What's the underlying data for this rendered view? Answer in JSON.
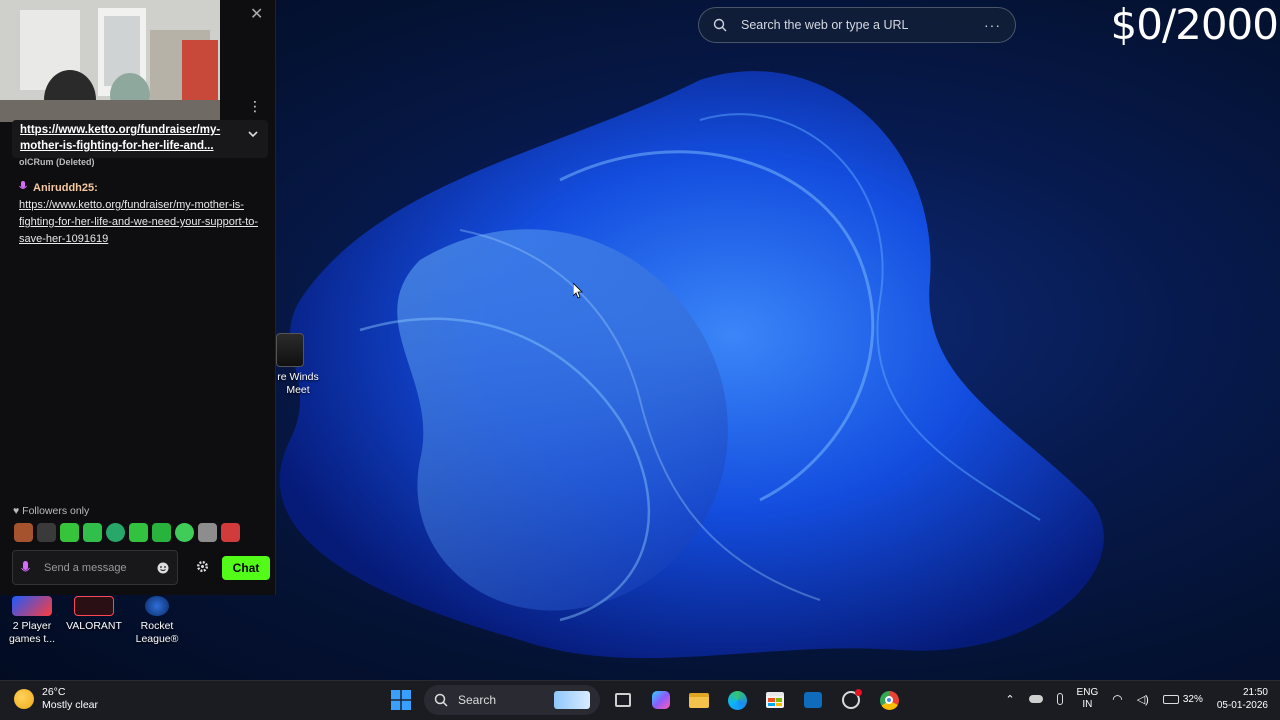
{
  "overlay": {
    "goal": "$0/2000"
  },
  "browser_search": {
    "placeholder": "Search the web or type a URL",
    "menu": "···"
  },
  "chat": {
    "pinned_link": "https://www.ketto.org/fundraiser/my-mother-is-fighting-for-her-life-and...",
    "deleted_line": "oICRum (Deleted)",
    "messages": [
      {
        "user": "Aniruddh25:",
        "link": "https://www.ketto.org/fundraiser/my-mother-is-fighting-for-her-life-and-we-need-your-support-to-save-her-1091619"
      }
    ],
    "followers_only": "Followers only",
    "input_placeholder": "Send a message",
    "send_label": "Chat",
    "accent_color": "#53fc18"
  },
  "desktop": {
    "icons": [
      {
        "label": "re Winds Meet",
        "icon": "game-icon"
      },
      {
        "label": "2 Player games  t...",
        "icon": "game-icon"
      },
      {
        "label": "VALORANT",
        "icon": "valorant-icon"
      },
      {
        "label": "Rocket League®",
        "icon": "rocket-league-icon"
      }
    ]
  },
  "taskbar": {
    "weather_temp": "26°C",
    "weather_desc": "Mostly clear",
    "search_label": "Search",
    "lang_top": "ENG",
    "lang_bottom": "IN",
    "battery": "32%",
    "time": "21:50",
    "date": "05-01-2026"
  }
}
